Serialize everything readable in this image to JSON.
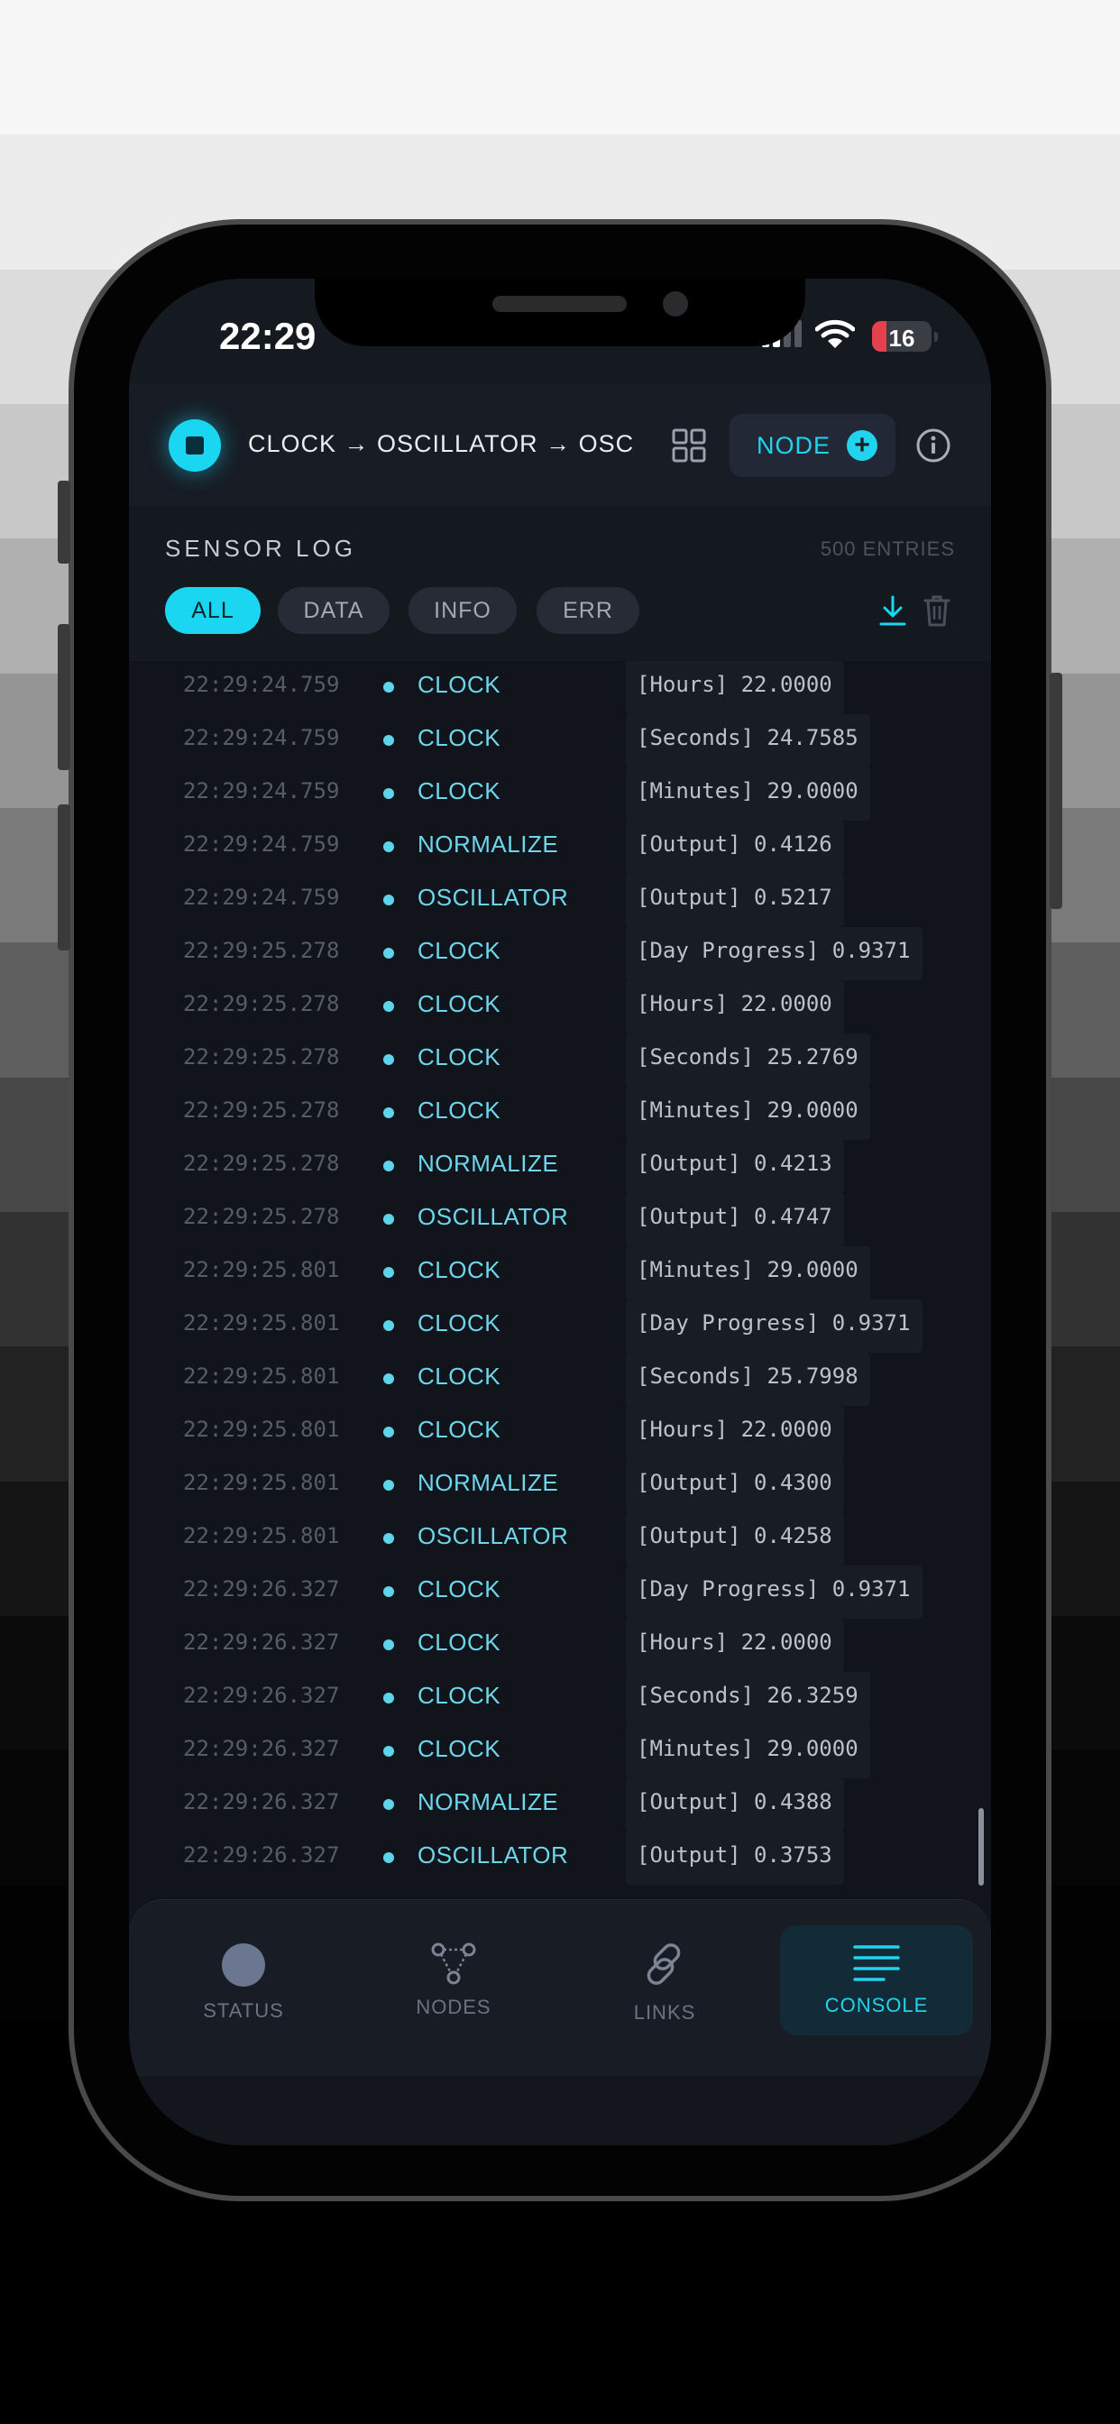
{
  "status_bar": {
    "time": "22:29",
    "battery": "16"
  },
  "header": {
    "pipeline": "CLOCK → OSCILLATOR → OSC",
    "node_button": "NODE"
  },
  "log": {
    "title": "SENSOR LOG",
    "entries_count": "500 ENTRIES",
    "filters": [
      "ALL",
      "DATA",
      "INFO",
      "ERR"
    ],
    "active_filter": "ALL",
    "rows": [
      {
        "time": "22:29:24.759",
        "source": "CLOCK",
        "value": "[Hours] 22.0000"
      },
      {
        "time": "22:29:24.759",
        "source": "CLOCK",
        "value": "[Seconds] 24.7585"
      },
      {
        "time": "22:29:24.759",
        "source": "CLOCK",
        "value": "[Minutes] 29.0000"
      },
      {
        "time": "22:29:24.759",
        "source": "NORMALIZE",
        "value": "[Output] 0.4126"
      },
      {
        "time": "22:29:24.759",
        "source": "OSCILLATOR",
        "value": "[Output] 0.5217"
      },
      {
        "time": "22:29:25.278",
        "source": "CLOCK",
        "value": "[Day Progress] 0.9371"
      },
      {
        "time": "22:29:25.278",
        "source": "CLOCK",
        "value": "[Hours] 22.0000"
      },
      {
        "time": "22:29:25.278",
        "source": "CLOCK",
        "value": "[Seconds] 25.2769"
      },
      {
        "time": "22:29:25.278",
        "source": "CLOCK",
        "value": "[Minutes] 29.0000"
      },
      {
        "time": "22:29:25.278",
        "source": "NORMALIZE",
        "value": "[Output] 0.4213"
      },
      {
        "time": "22:29:25.278",
        "source": "OSCILLATOR",
        "value": "[Output] 0.4747"
      },
      {
        "time": "22:29:25.801",
        "source": "CLOCK",
        "value": "[Minutes] 29.0000"
      },
      {
        "time": "22:29:25.801",
        "source": "CLOCK",
        "value": "[Day Progress] 0.9371"
      },
      {
        "time": "22:29:25.801",
        "source": "CLOCK",
        "value": "[Seconds] 25.7998"
      },
      {
        "time": "22:29:25.801",
        "source": "CLOCK",
        "value": "[Hours] 22.0000"
      },
      {
        "time": "22:29:25.801",
        "source": "NORMALIZE",
        "value": "[Output] 0.4300"
      },
      {
        "time": "22:29:25.801",
        "source": "OSCILLATOR",
        "value": "[Output] 0.4258"
      },
      {
        "time": "22:29:26.327",
        "source": "CLOCK",
        "value": "[Day Progress] 0.9371"
      },
      {
        "time": "22:29:26.327",
        "source": "CLOCK",
        "value": "[Hours] 22.0000"
      },
      {
        "time": "22:29:26.327",
        "source": "CLOCK",
        "value": "[Seconds] 26.3259"
      },
      {
        "time": "22:29:26.327",
        "source": "CLOCK",
        "value": "[Minutes] 29.0000"
      },
      {
        "time": "22:29:26.327",
        "source": "NORMALIZE",
        "value": "[Output] 0.4388"
      },
      {
        "time": "22:29:26.327",
        "source": "OSCILLATOR",
        "value": "[Output] 0.3753"
      }
    ]
  },
  "tabbar": {
    "tabs": [
      {
        "label": "STATUS",
        "icon": "circle-icon"
      },
      {
        "label": "NODES",
        "icon": "nodes-graph-icon"
      },
      {
        "label": "LINKS",
        "icon": "link-icon"
      },
      {
        "label": "CONSOLE",
        "icon": "console-lines-icon"
      }
    ],
    "active": "CONSOLE"
  },
  "colors": {
    "accent": "#1bd6f0",
    "background": "#11141a",
    "header": "#171c25",
    "battery_low": "#e5414d"
  }
}
